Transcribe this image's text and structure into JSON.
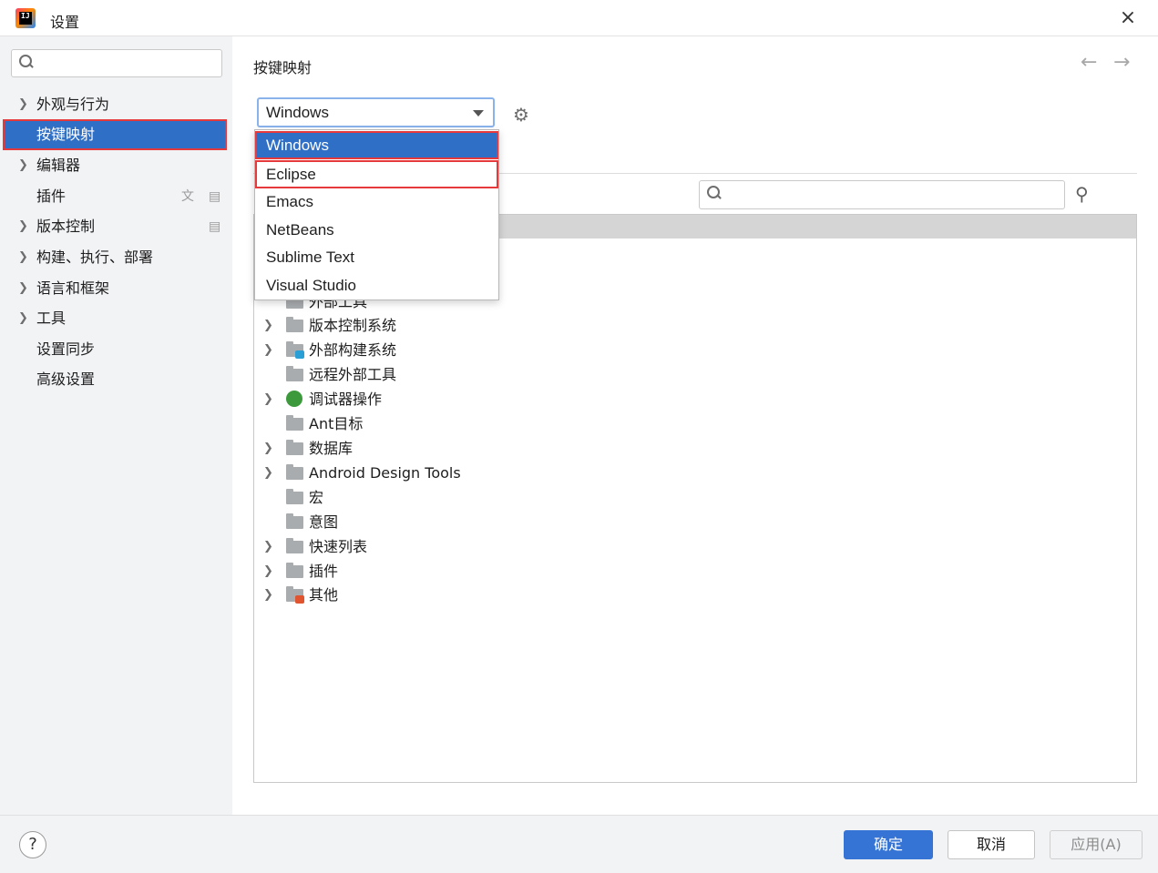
{
  "window": {
    "title": "设置",
    "close_icon": "×"
  },
  "sidebar": {
    "search_placeholder": "",
    "items": [
      {
        "label": "外观与行为",
        "expandable": true
      },
      {
        "label": "按键映射",
        "expandable": false,
        "selected": true
      },
      {
        "label": "编辑器",
        "expandable": true
      },
      {
        "label": "插件",
        "expandable": false
      },
      {
        "label": "版本控制",
        "expandable": true
      },
      {
        "label": "构建、执行、部署",
        "expandable": true
      },
      {
        "label": "语言和框架",
        "expandable": true
      },
      {
        "label": "工具",
        "expandable": true
      },
      {
        "label": "设置同步",
        "expandable": false
      },
      {
        "label": "高级设置",
        "expandable": false
      }
    ]
  },
  "main": {
    "title": "按键映射",
    "back_arrow": "←",
    "forward_arrow": "→",
    "keymap_select": {
      "value": "Windows",
      "options": [
        "Windows",
        "Eclipse",
        "Emacs",
        "NetBeans",
        "Sublime Text",
        "Visual Studio"
      ]
    },
    "search_placeholder": "",
    "tree": [
      {
        "label": "外部工具",
        "expandable": false
      },
      {
        "label": "版本控制系统",
        "expandable": true
      },
      {
        "label": "外部构建系统",
        "expandable": true
      },
      {
        "label": "远程外部工具",
        "expandable": false
      },
      {
        "label": "调试器操作",
        "expandable": true
      },
      {
        "label": "Ant目标",
        "expandable": false
      },
      {
        "label": "数据库",
        "expandable": true
      },
      {
        "label": "Android Design Tools",
        "expandable": true
      },
      {
        "label": "宏",
        "expandable": false
      },
      {
        "label": "意图",
        "expandable": false
      },
      {
        "label": "快速列表",
        "expandable": true
      },
      {
        "label": "插件",
        "expandable": true
      },
      {
        "label": "其他",
        "expandable": true
      }
    ]
  },
  "footer": {
    "help_label": "?",
    "ok_label": "确定",
    "cancel_label": "取消",
    "apply_label": "应用(A)"
  },
  "colors": {
    "accent": "#2f6fc6",
    "highlight_outline": "#e5393b",
    "ok_button": "#3574d4"
  }
}
